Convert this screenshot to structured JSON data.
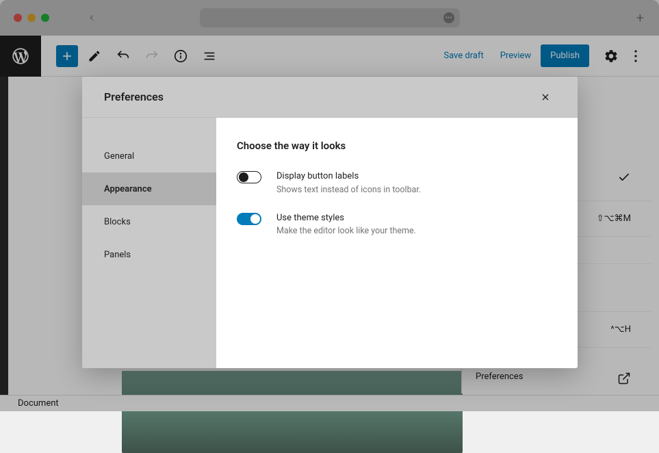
{
  "browser": {
    "new_tab_icon": "+"
  },
  "header": {
    "save_draft": "Save draft",
    "preview": "Preview",
    "publish": "Publish"
  },
  "footer": {
    "breadcrumb": "Document"
  },
  "side_panel": {
    "shortcut1": "⇧⌥⌘M",
    "shortcut2": "^⌥H",
    "pref_label": "Preferences"
  },
  "modal": {
    "title": "Preferences",
    "nav": {
      "general": "General",
      "appearance": "Appearance",
      "blocks": "Blocks",
      "panels": "Panels"
    },
    "section_title": "Choose the way it looks",
    "settings": [
      {
        "label": "Display button labels",
        "desc": "Shows text instead of icons in toolbar.",
        "enabled": false
      },
      {
        "label": "Use theme styles",
        "desc": "Make the editor look like your theme.",
        "enabled": true
      }
    ]
  }
}
